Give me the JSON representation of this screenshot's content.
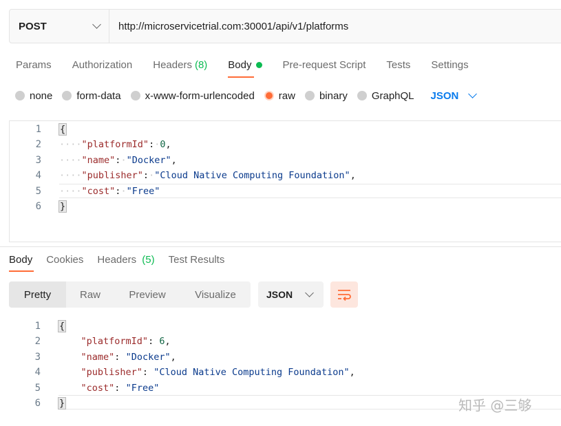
{
  "request": {
    "method": "POST",
    "url": "http://microservicetrial.com:30001/api/v1/platforms",
    "tabs": [
      {
        "label": "Params"
      },
      {
        "label": "Authorization"
      },
      {
        "label": "Headers",
        "count": "(8)"
      },
      {
        "label": "Body",
        "active": true
      },
      {
        "label": "Pre-request Script"
      },
      {
        "label": "Tests"
      },
      {
        "label": "Settings"
      }
    ],
    "body_types": [
      "none",
      "form-data",
      "x-www-form-urlencoded",
      "raw",
      "binary",
      "GraphQL"
    ],
    "selected_body_type": "raw",
    "body_format": "JSON",
    "code_lines": [
      {
        "n": "1",
        "text": "{"
      },
      {
        "n": "2",
        "key": "\"platformId\"",
        "value": "0",
        "value_type": "number"
      },
      {
        "n": "3",
        "key": "\"name\"",
        "value": "\"Docker\"",
        "value_type": "string"
      },
      {
        "n": "4",
        "key": "\"publisher\"",
        "value": "\"Cloud Native Computing Foundation\"",
        "value_type": "string"
      },
      {
        "n": "5",
        "key": "\"cost\"",
        "value": "\"Free\"",
        "value_type": "string"
      },
      {
        "n": "6",
        "text": "}"
      }
    ]
  },
  "response": {
    "tabs": [
      {
        "label": "Body",
        "active": true
      },
      {
        "label": "Cookies"
      },
      {
        "label": "Headers",
        "count": "(5)"
      },
      {
        "label": "Test Results"
      }
    ],
    "views": [
      "Pretty",
      "Raw",
      "Preview",
      "Visualize"
    ],
    "active_view": "Pretty",
    "format": "JSON",
    "code_lines": [
      {
        "n": "1",
        "text": "{"
      },
      {
        "n": "2",
        "key": "\"platformId\"",
        "value": "6",
        "value_type": "number"
      },
      {
        "n": "3",
        "key": "\"name\"",
        "value": "\"Docker\"",
        "value_type": "string"
      },
      {
        "n": "4",
        "key": "\"publisher\"",
        "value": "\"Cloud Native Computing Foundation\"",
        "value_type": "string"
      },
      {
        "n": "5",
        "key": "\"cost\"",
        "value": "\"Free\"",
        "value_type": "string"
      },
      {
        "n": "6",
        "text": "}"
      }
    ]
  },
  "watermark": "知乎 @三够",
  "colors": {
    "accent": "#ff6c37",
    "active_dot": "#0cbb52",
    "link": "#097bed"
  }
}
